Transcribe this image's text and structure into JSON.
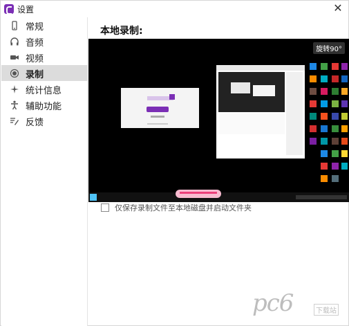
{
  "window": {
    "title": "设置"
  },
  "sidebar": {
    "items": [
      {
        "label": "常规",
        "icon": "phone-icon",
        "active": false
      },
      {
        "label": "音频",
        "icon": "headphones-icon",
        "active": false
      },
      {
        "label": "视频",
        "icon": "video-camera-icon",
        "active": false
      },
      {
        "label": "录制",
        "icon": "record-icon",
        "active": true
      },
      {
        "label": "统计信息",
        "icon": "sparkle-icon",
        "active": false
      },
      {
        "label": "辅助功能",
        "icon": "accessibility-icon",
        "active": false
      },
      {
        "label": "反馈",
        "icon": "feedback-icon",
        "active": false
      }
    ]
  },
  "main": {
    "section_title": "本地录制:",
    "preview": {
      "rotate_label": "旋转90°"
    },
    "checkbox": {
      "label": "仅保存录制文件至本地磁盘并启动文件夹",
      "checked": false
    }
  },
  "watermark": {
    "text": "pc6",
    "sub": "下载站"
  },
  "colors": {
    "accent": "#7b2fb5",
    "sidebar_active": "#dcdcdc",
    "preview_bg": "#000000"
  }
}
